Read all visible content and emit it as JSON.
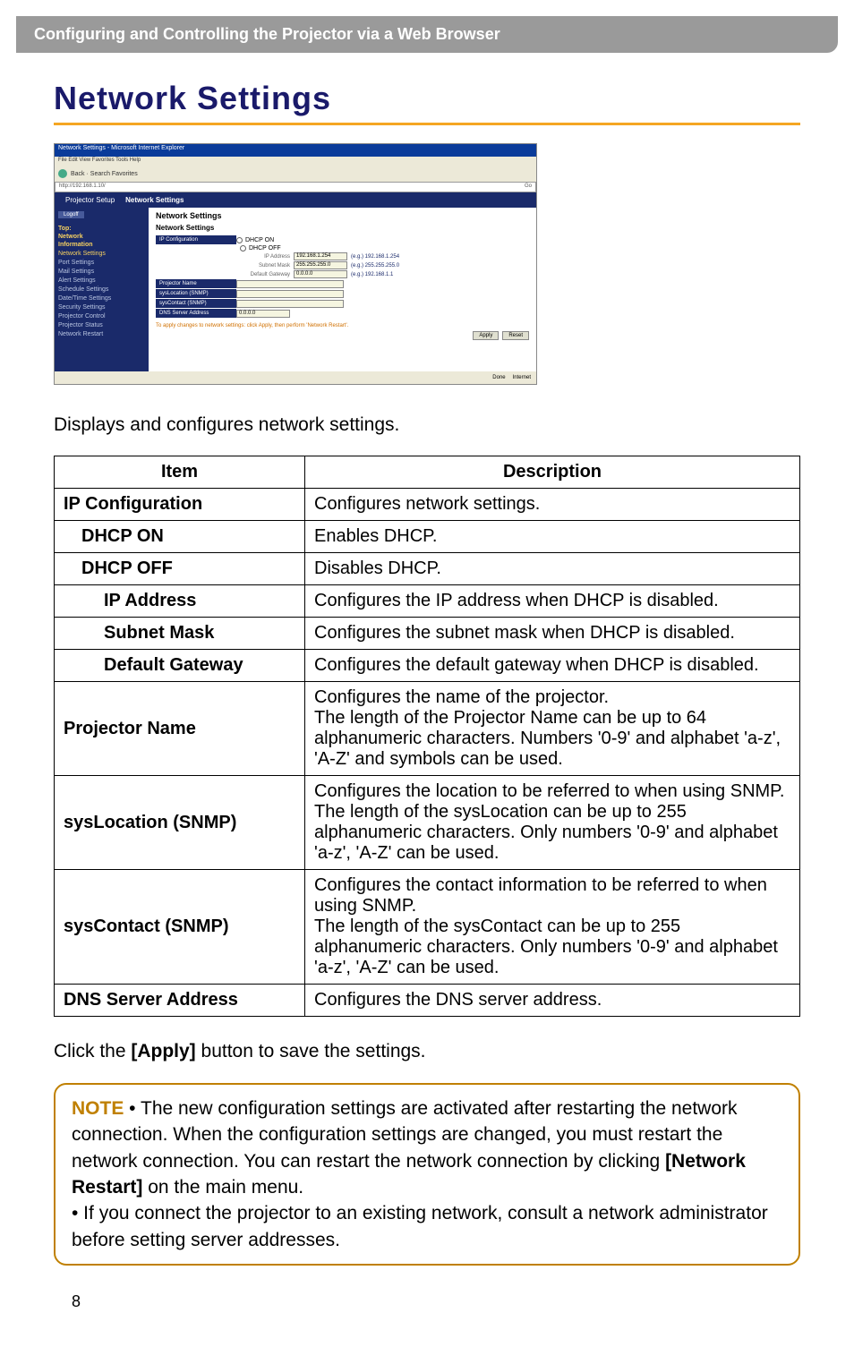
{
  "banner": "Configuring and Controlling the Projector via a Web Browser",
  "pageTitle": "Network Settings",
  "screenshot": {
    "windowTitle": "Network Settings - Microsoft Internet Explorer",
    "menubar": "File  Edit  View  Favorites  Tools  Help",
    "toolbar": "Back  ·  Search  Favorites",
    "address": "http://192.168.1.10/",
    "goLabel": "Go",
    "headerTab": "Projector Setup",
    "headerTitle": "Network Settings",
    "logoff": "Logoff",
    "navTop": "Top:",
    "navNetInfo1": "Network",
    "navNetInfo2": "Information",
    "navItems": [
      "Network Settings",
      "Port Settings",
      "Mail Settings",
      "Alert Settings",
      "Schedule Settings",
      "Date/Time Settings",
      "Security Settings",
      "Projector Control",
      "Projector Status",
      "Network Restart"
    ],
    "sectionTitle": "Network Settings",
    "ipConfigLabel": "IP Configuration",
    "dhcpOn": "DHCP ON",
    "dhcpOff": "DHCP OFF",
    "ipAddrLabel": "IP Address",
    "ipAddrVal": "192.168.1.254",
    "ipAddrEg": "(e.g.) 192.168.1.254",
    "subnetLabel": "Subnet Mask",
    "subnetVal": "255.255.255.0",
    "subnetEg": "(e.g.) 255.255.255.0",
    "gatewayLabel": "Default Gateway",
    "gatewayVal": "0.0.0.0",
    "gatewayEg": "(e.g.) 192.168.1.1",
    "projNameLabel": "Projector Name",
    "sysLocLabel": "sysLocation (SNMP)",
    "sysConLabel": "sysContact (SNMP)",
    "dnsLabel": "DNS Server Address",
    "dnsVal": "0.0.0.0",
    "applyNote": "To apply changes to network settings: click Apply, then perform 'Network Restart'.",
    "applyBtn": "Apply",
    "resetBtn": "Reset",
    "statusDone": "Done",
    "statusNet": "Internet"
  },
  "introText": "Displays and configures network settings.",
  "table": {
    "head": {
      "item": "Item",
      "desc": "Description"
    },
    "rows": [
      {
        "item": "IP Configuration",
        "desc": "Configures network settings.",
        "bold": true,
        "indent": 0
      },
      {
        "item": "DHCP ON",
        "desc": "Enables DHCP.",
        "bold": true,
        "indent": 1
      },
      {
        "item": "DHCP OFF",
        "desc": "Disables DHCP.",
        "bold": true,
        "indent": 1
      },
      {
        "item": "IP Address",
        "desc": "Configures the IP address when DHCP is disabled.",
        "bold": true,
        "indent": 2
      },
      {
        "item": "Subnet Mask",
        "desc": "Configures the subnet mask when DHCP is disabled.",
        "bold": true,
        "indent": 2
      },
      {
        "item": "Default Gateway",
        "desc": "Configures the default gateway when DHCP is disabled.",
        "bold": true,
        "indent": 2
      },
      {
        "item": "Projector Name",
        "desc": "Configures the name of the projector.\nThe length of the Projector Name can be up to 64 alphanumeric characters. Numbers '0-9' and alphabet 'a-z', 'A-Z' and symbols can be used.",
        "bold": true,
        "indent": 0
      },
      {
        "item": "sysLocation (SNMP)",
        "desc": "Configures the location to be referred to when using SNMP. The length of the sysLocation can be up to 255 alphanumeric characters. Only numbers '0-9' and alphabet 'a-z', 'A-Z' can be used.",
        "bold": true,
        "indent": 0
      },
      {
        "item": "sysContact (SNMP)",
        "desc": "Configures the contact information to be referred to when using SNMP.\nThe length of the sysContact can be up to 255 alphanumeric characters. Only numbers '0-9' and alphabet 'a-z', 'A-Z' can be used.",
        "bold": true,
        "indent": 0
      },
      {
        "item": "DNS Server Address",
        "desc": "Configures the DNS server address.",
        "bold": true,
        "indent": 0
      }
    ]
  },
  "applyText": {
    "pre": "Click the ",
    "bold": "[Apply]",
    "post": " button to save the settings."
  },
  "note": {
    "label": "NOTE",
    "bullet1a": " • The new configuration settings are activated after restarting the network connection. When the configuration settings are changed, you must restart the network connection. You can restart the network connection by clicking ",
    "bullet1bold": "[Network Restart]",
    "bullet1b": " on the main menu.",
    "bullet2": "• If you connect the projector to an existing network, consult a network administrator before setting server addresses."
  },
  "pageNumber": "8"
}
